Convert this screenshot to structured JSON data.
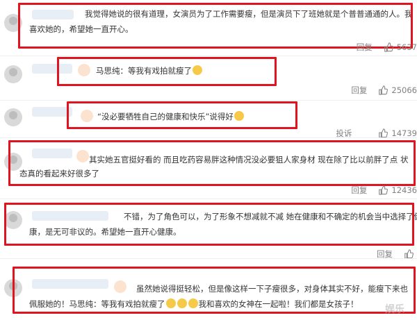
{
  "comments": [
    {
      "text_lines": [
        "我觉得她说的很有道理，女演员为了工作需要瘦，但是演员下了班她就是个普普通通的人。我",
        "喜欢她的，希望她一直开心。"
      ],
      "reply_label": "回复",
      "like_count": "5637"
    },
    {
      "text_lines": [
        "马思纯：等我有戏拍就瘦了"
      ],
      "reply_label": "回复",
      "like_count": "25066"
    },
    {
      "text_lines": [
        "“没必要牺牲自己的健康和快乐”说得好"
      ],
      "report_label": "投诉",
      "like_count": "14739"
    },
    {
      "text_lines": [
        "其实她五官挺好看的 而且吃药容易胖这种情况没必要狙人家身材 现在除了比以前胖了点 状",
        "态真的看起来好很多了"
      ],
      "reply_label": "回复",
      "like_count": "12436"
    },
    {
      "text_lines": [
        "不错，为了角色可以，为了形象不想减就不减 她在健康和不确定的机会当中选择了健",
        "康，是无可非议的。希望她一直开心健康。"
      ],
      "reply_label": "回复",
      "like_count": ""
    },
    {
      "text_lines": [
        "虽然她说得挺轻松，但是像这样一下子瘦很多，对身体其实不好，能瘦下来也",
        "佩服她的！马思纯：等我有戏拍就瘦了",
        "我和喜欢的女神在一起啦！我们都是女孩子！"
      ],
      "reply_label": "回复",
      "like_count": ""
    }
  ],
  "watermark": "娱乐",
  "colors": {
    "highlight_box": "#e0141e",
    "action_text": "#808080"
  },
  "icons": [
    "avatar",
    "thumbs-up-icon",
    "emoji-icon"
  ]
}
